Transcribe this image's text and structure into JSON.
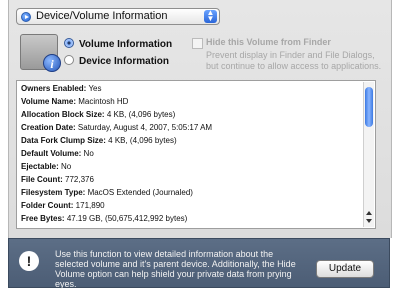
{
  "popup": {
    "label": "Device/Volume Information",
    "left_icon": "play-icon",
    "arrows_icon": "updown-arrows-icon"
  },
  "icons": {
    "drive": "drive-info-icon",
    "info_glyph": "i",
    "warning": "exclamation-icon",
    "warning_glyph": "!"
  },
  "radios": [
    {
      "label": "Volume Information",
      "selected": true
    },
    {
      "label": "Device Information",
      "selected": false
    }
  ],
  "hide_volume": {
    "title": "Hide this Volume from Finder",
    "description": "Prevent display in Finder and File Dialogs, but continue to allow access to applications.",
    "enabled": false
  },
  "rows": [
    {
      "label": "Owners Enabled:",
      "value": "Yes"
    },
    {
      "label": "Volume Name:",
      "value": "Macintosh HD"
    },
    {
      "label": "Allocation Block Size:",
      "value": "4 KB, (4,096 bytes)"
    },
    {
      "label": "Creation Date:",
      "value": "Saturday, August 4, 2007, 5:05:17 AM"
    },
    {
      "label": "Data Fork Clump Size:",
      "value": "4 KB, (4,096 bytes)"
    },
    {
      "label": "Default Volume:",
      "value": "No"
    },
    {
      "label": "Ejectable:",
      "value": "No"
    },
    {
      "label": "File Count:",
      "value": "772,376"
    },
    {
      "label": "Filesystem Type:",
      "value": "MacOS Extended (Journaled)"
    },
    {
      "label": "Folder Count:",
      "value": "171,890"
    },
    {
      "label": "Free Bytes:",
      "value": "47.19 GB, (50,675,412,992 bytes)"
    }
  ],
  "footer": {
    "message": "Use this function to view detailed information about the selected volume and it's parent device. Additionally, the Hide Volume option can help shield your private data from prying eyes.",
    "button": "Update"
  }
}
